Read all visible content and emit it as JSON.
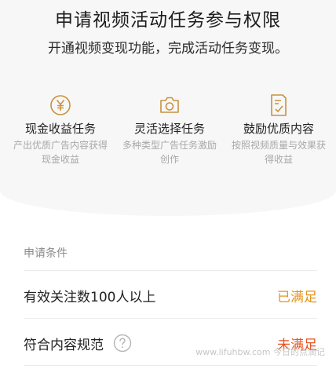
{
  "header": {
    "title": "申请视频活动任务参与权限",
    "subtitle": "开通视频变现功能，完成活动任务变现。"
  },
  "features": [
    {
      "icon": "yuan-coin-icon",
      "title": "现金收益任务",
      "desc": "产出优质广告内容获得现金收益"
    },
    {
      "icon": "camera-icon",
      "title": "灵活选择任务",
      "desc": "多种类型广告任务激励创作"
    },
    {
      "icon": "document-check-icon",
      "title": "鼓励优质内容",
      "desc": "按照视频质量与效果获得收益"
    }
  ],
  "conditions": {
    "section_label": "申请条件",
    "items": [
      {
        "label": "有效关注数100人以上",
        "status": "已满足"
      },
      {
        "label": "符合内容规范",
        "status": "未满足",
        "has_help": true
      }
    ]
  },
  "watermark": "www.lifuhbw.com 今日的点滴记",
  "colors": {
    "accent": "#c8923e",
    "status_ok": "#e6941f",
    "status_no": "#e8511f"
  }
}
